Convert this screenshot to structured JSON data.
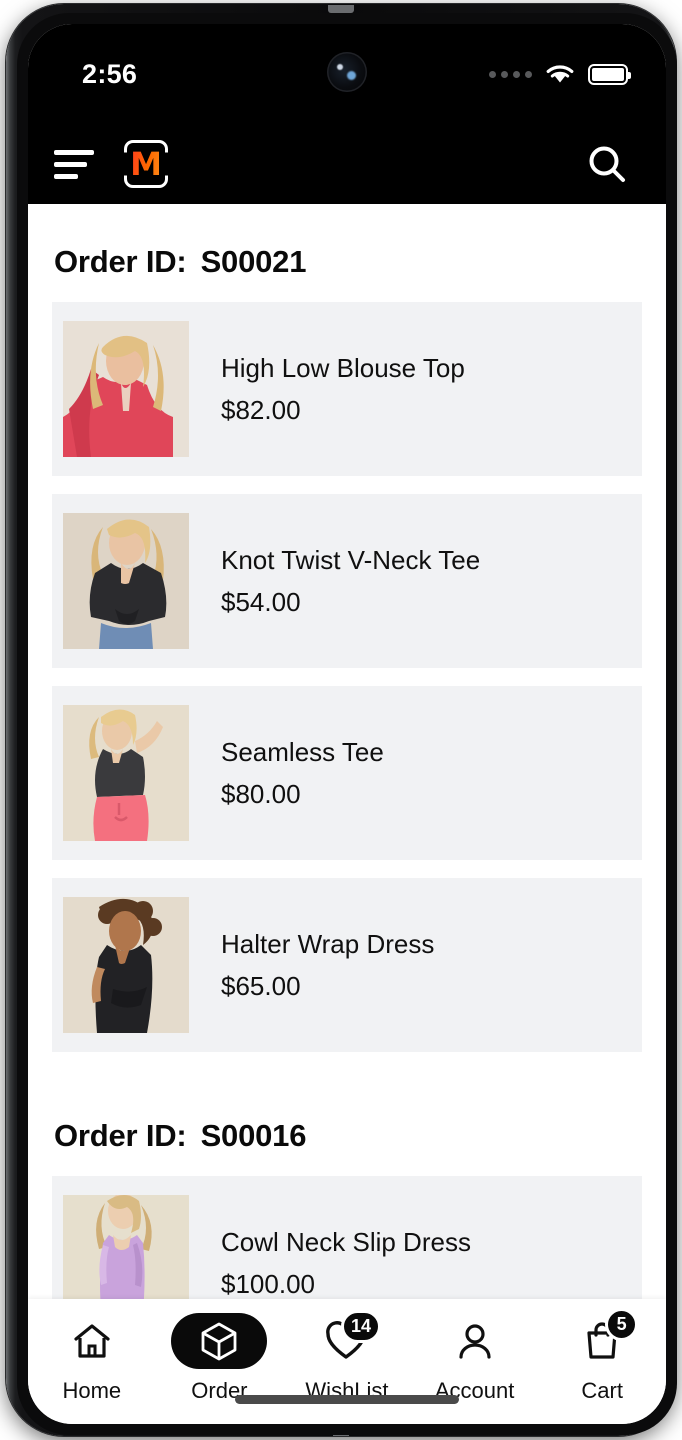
{
  "status_bar": {
    "time": "2:56",
    "signal_icon": "signal-dots-icon",
    "wifi_icon": "wifi-icon",
    "battery_icon": "battery-full-icon"
  },
  "app_bar": {
    "menu_icon": "hamburger-menu-icon",
    "logo_text": "M",
    "logo_name": "myntra-logo",
    "search_icon": "search-icon"
  },
  "colors": {
    "accent": "#ff3b1f",
    "accent_secondary": "#ff8c1a",
    "header_bg": "#000000",
    "card_bg": "#f1f2f4",
    "text": "#101010",
    "active_pill": "#0a0a0a"
  },
  "orders": [
    {
      "label": "Order ID:",
      "id": "S00021",
      "items": [
        {
          "name": "High Low Blouse Top",
          "price": "$82.00"
        },
        {
          "name": "Knot Twist V-Neck Tee",
          "price": "$54.00"
        },
        {
          "name": "Seamless Tee",
          "price": "$80.00"
        },
        {
          "name": "Halter Wrap Dress",
          "price": "$65.00"
        }
      ]
    },
    {
      "label": "Order ID:",
      "id": "S00016",
      "items": [
        {
          "name": "Cowl Neck Slip Dress",
          "price": "$100.00"
        }
      ]
    }
  ],
  "bottom_nav": {
    "items": [
      {
        "label": "Home",
        "icon": "home-icon",
        "active": false,
        "badge": null
      },
      {
        "label": "Order",
        "icon": "cube-icon",
        "active": true,
        "badge": null
      },
      {
        "label": "WishList",
        "icon": "heart-icon",
        "active": false,
        "badge": "14"
      },
      {
        "label": "Account",
        "icon": "person-icon",
        "active": false,
        "badge": null
      },
      {
        "label": "Cart",
        "icon": "bag-icon",
        "active": false,
        "badge": "5"
      }
    ]
  }
}
